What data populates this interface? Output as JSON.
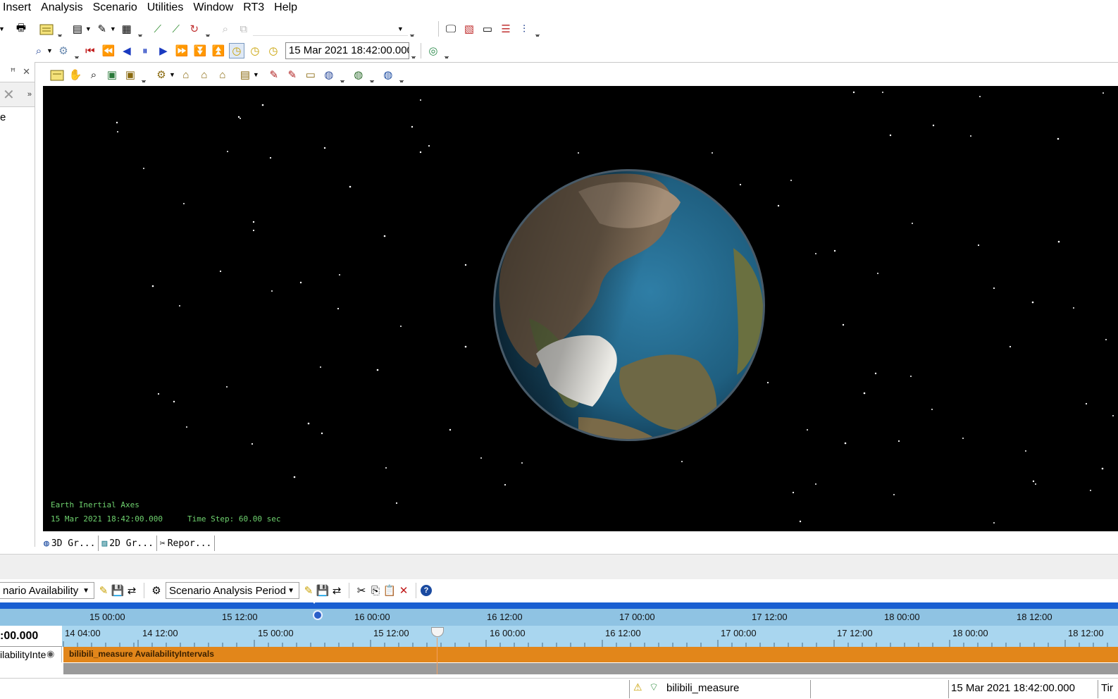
{
  "menu": [
    "Insert",
    "Analysis",
    "Scenario",
    "Utilities",
    "Window",
    "RT3",
    "Help"
  ],
  "toolbar": {
    "animation_time": "15 Mar 2021 18:42:00.000"
  },
  "left_panel": {
    "text_fragment": "e"
  },
  "viewport": {
    "axes_label": "Earth Inertial Axes",
    "time_readout": "15 Mar 2021 18:42:00.000",
    "time_step": "Time Step: 60.00 sec"
  },
  "view_tabs": [
    {
      "label": "3D Gr...",
      "icon": "globe-icon"
    },
    {
      "label": "2D Gr...",
      "icon": "map-icon"
    },
    {
      "label": "Repor...",
      "icon": "tools-icon"
    }
  ],
  "timeline_toolbar": {
    "availability_combo": "nario Availability",
    "period_combo": "Scenario Analysis Period"
  },
  "timeline": {
    "upper_ticks": [
      "15 00:00",
      "15 12:00",
      "16 00:00",
      "16 12:00",
      "17 00:00",
      "17 12:00",
      "18 00:00",
      "18 12:00"
    ],
    "lower_ticks": [
      "14 04:00",
      "14 12:00",
      "15 00:00",
      "15 12:00",
      "16 00:00",
      "16 12:00",
      "17 00:00",
      "17 12:00",
      "18 00:00",
      "18 12:00"
    ],
    "current_time_fragment": ":00.000",
    "row_label": "ilabilityInte",
    "bar_label": "bilibili_measure AvailabilityIntervals"
  },
  "statusbar": {
    "object": "bilibili_measure",
    "time": "15 Mar 2021 18:42:00.000",
    "trailing": "Tir"
  },
  "colors": {
    "viewport_bg": "#000000",
    "overlay_text": "#6fd36f",
    "timeline_blue": "#1a5fd1",
    "availability_bar": "#e2861a"
  }
}
